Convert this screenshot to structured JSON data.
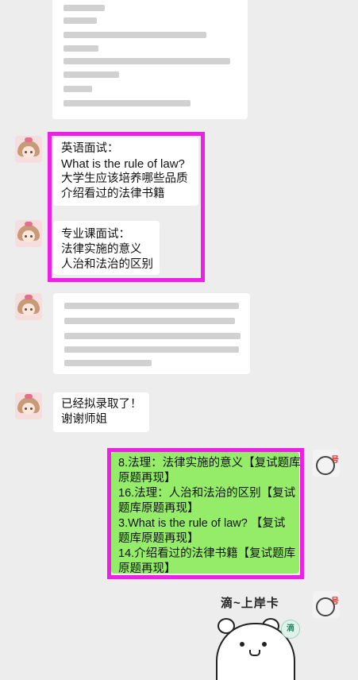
{
  "messages": {
    "english_interview": {
      "lines": [
        "英语面试：",
        "What is the rule of law?",
        "大学生应该培养哪些品质",
        "介绍看过的法律书籍"
      ]
    },
    "major_interview": {
      "lines": [
        "专业课面试：",
        "法律实施的意义",
        "人治和法治的区别"
      ]
    },
    "admitted": {
      "lines": [
        "已经拟录取了！",
        "谢谢师姐"
      ]
    },
    "reply": {
      "lines": [
        "8.法理：法律实施的意义【复试题库",
        "原题再现】",
        "16.法理：人治和法治的区别【复试",
        "题库原题再现】",
        "3.What is the rule of law?  【复试",
        "题库原题再现】",
        "14.介绍看过的法律书籍【复试题库",
        "原题再现】"
      ]
    },
    "sticker": {
      "title": "滴~上岸卡",
      "stamp": "滴"
    }
  },
  "colors": {
    "background": "#ededed",
    "own_bubble": "#95ec69",
    "other_bubble": "#ffffff",
    "highlight": "#ee1fe6"
  },
  "icons": [
    "avatar-girl",
    "avatar-sketch",
    "bear-sticker"
  ]
}
